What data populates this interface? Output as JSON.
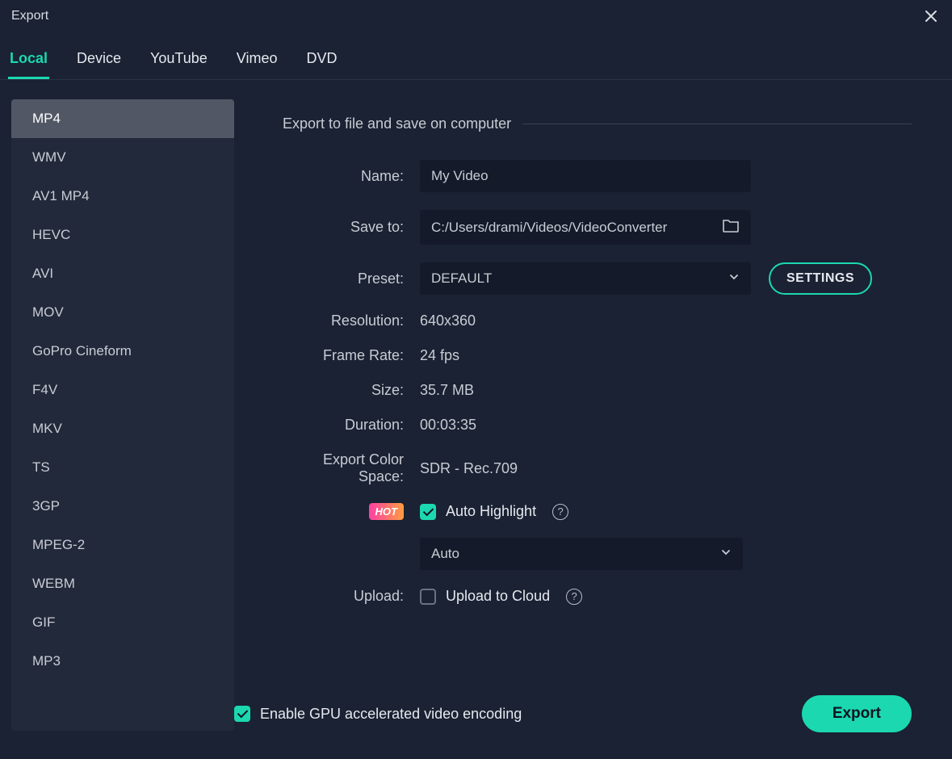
{
  "window": {
    "title": "Export"
  },
  "tabs": [
    {
      "label": "Local",
      "active": true
    },
    {
      "label": "Device",
      "active": false
    },
    {
      "label": "YouTube",
      "active": false
    },
    {
      "label": "Vimeo",
      "active": false
    },
    {
      "label": "DVD",
      "active": false
    }
  ],
  "formats": [
    "MP4",
    "WMV",
    "AV1 MP4",
    "HEVC",
    "AVI",
    "MOV",
    "GoPro Cineform",
    "F4V",
    "MKV",
    "TS",
    "3GP",
    "MPEG-2",
    "WEBM",
    "GIF",
    "MP3"
  ],
  "formats_selected_index": 0,
  "panel": {
    "heading": "Export to file and save on computer",
    "labels": {
      "name": "Name:",
      "save_to": "Save to:",
      "preset": "Preset:",
      "resolution": "Resolution:",
      "frame_rate": "Frame Rate:",
      "size": "Size:",
      "duration": "Duration:",
      "color_space": "Export Color Space:",
      "upload": "Upload:"
    },
    "name_value": "My Video",
    "save_to_value": "C:/Users/drami/Videos/VideoConverter",
    "preset_value": "DEFAULT",
    "settings_button": "SETTINGS",
    "resolution_value": "640x360",
    "frame_rate_value": "24 fps",
    "size_value": "35.7 MB",
    "duration_value": "00:03:35",
    "color_space_value": "SDR - Rec.709",
    "hot_badge": "HOT",
    "auto_highlight_label": "Auto Highlight",
    "auto_highlight_checked": true,
    "auto_highlight_mode": "Auto",
    "upload_cloud_label": "Upload to Cloud",
    "upload_cloud_checked": false,
    "gpu_label": "Enable GPU accelerated video encoding",
    "gpu_checked": true,
    "export_button": "Export"
  }
}
